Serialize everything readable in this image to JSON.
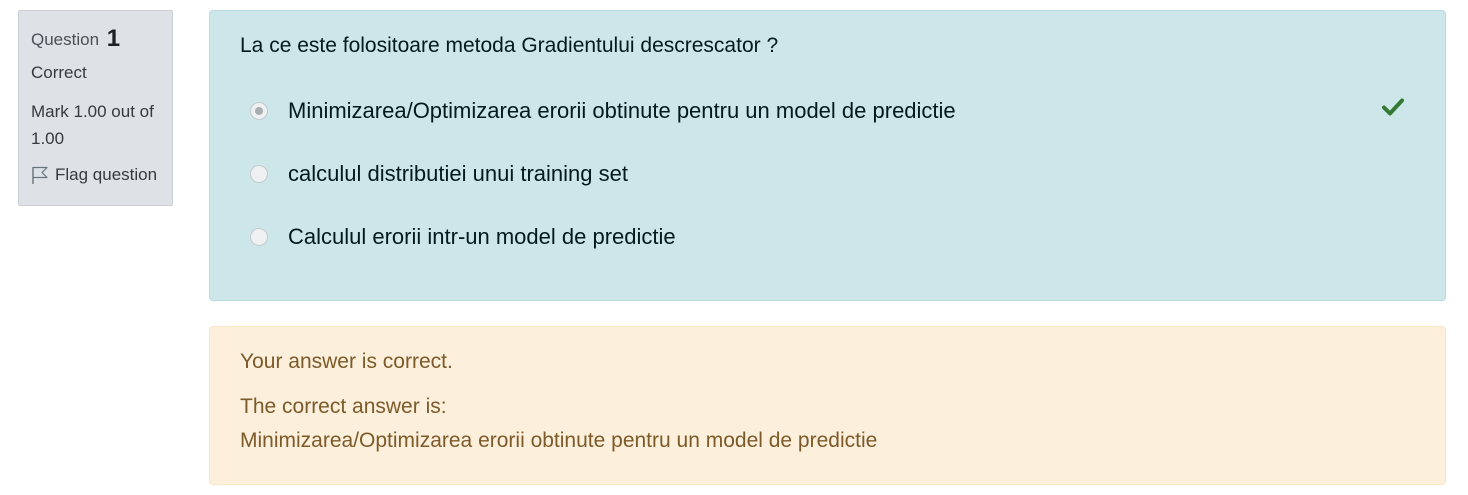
{
  "info": {
    "question_label": "Question",
    "question_number": "1",
    "state": "Correct",
    "grade": "Mark 1.00 out of 1.00",
    "flag_label": "Flag question"
  },
  "question": {
    "text": "La ce este folositoare metoda Gradientului descrescator ?",
    "answers": [
      {
        "label": "Minimizarea/Optimizarea erorii obtinute pentru un model de predictie",
        "selected": true,
        "correct": true
      },
      {
        "label": "calculul distributiei unui training set",
        "selected": false,
        "correct": false
      },
      {
        "label": "Calculul erorii intr-un model de predictie",
        "selected": false,
        "correct": false
      }
    ]
  },
  "feedback": {
    "result": "Your answer is correct.",
    "right_answer_intro": "The correct answer is:",
    "right_answer": "Minimizarea/Optimizarea erorii obtinute pentru un model de predictie"
  },
  "icons": {
    "correct": "check-icon",
    "flag": "flag-icon"
  },
  "colors": {
    "info_bg": "#dee2e6",
    "question_bg": "#cce6ea",
    "feedback_bg": "#fcefdc",
    "correct_check": "#357a32"
  }
}
